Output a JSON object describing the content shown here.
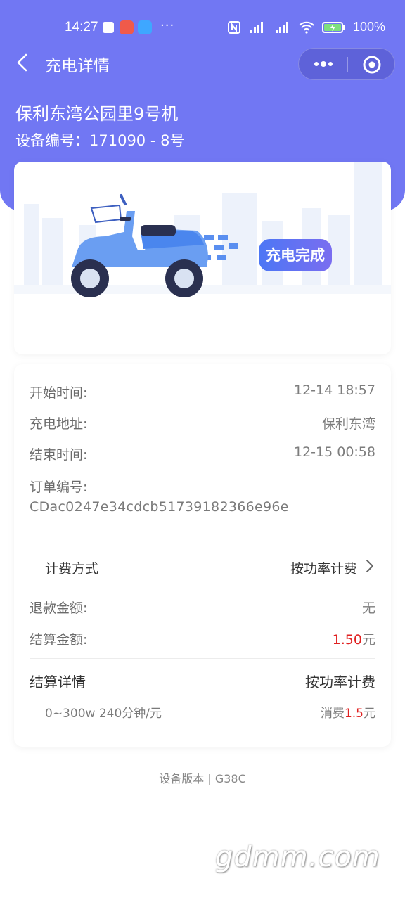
{
  "status_bar": {
    "time": "14:27",
    "battery": "100%",
    "more_dots": "···"
  },
  "nav": {
    "title": "充电详情"
  },
  "station": {
    "name": "保利东湾公园里9号机",
    "device_no": "设备编号：171090 - 8号"
  },
  "hero": {
    "status": "充电完成"
  },
  "info": {
    "start_time_label": "开始时间:",
    "start_time": "12-14 18:57",
    "address_label": "充电地址:",
    "address": "保利东湾",
    "end_time_label": "结束时间:",
    "end_time": "12-15 00:58",
    "order_label": "订单编号:",
    "order_id": "CDac0247e34cdcb51739182366e96e",
    "billing_label": "计费方式",
    "billing_value": "按功率计费",
    "refund_label": "退款金额:",
    "refund_value": "无",
    "settle_label": "结算金额:",
    "settle_amount": "1.50",
    "settle_unit": "元",
    "detail_title": "结算详情",
    "detail_value": "按功率计费",
    "rate": "0~300w 240分钟/元",
    "consume_prefix": "消费",
    "consume_amount": "1.5",
    "consume_unit": "元"
  },
  "footer": {
    "version": "设备版本 | G38C"
  },
  "watermark": "gdmm.com",
  "colors": {
    "accent": "#7177f3",
    "price_red": "#e02020"
  }
}
